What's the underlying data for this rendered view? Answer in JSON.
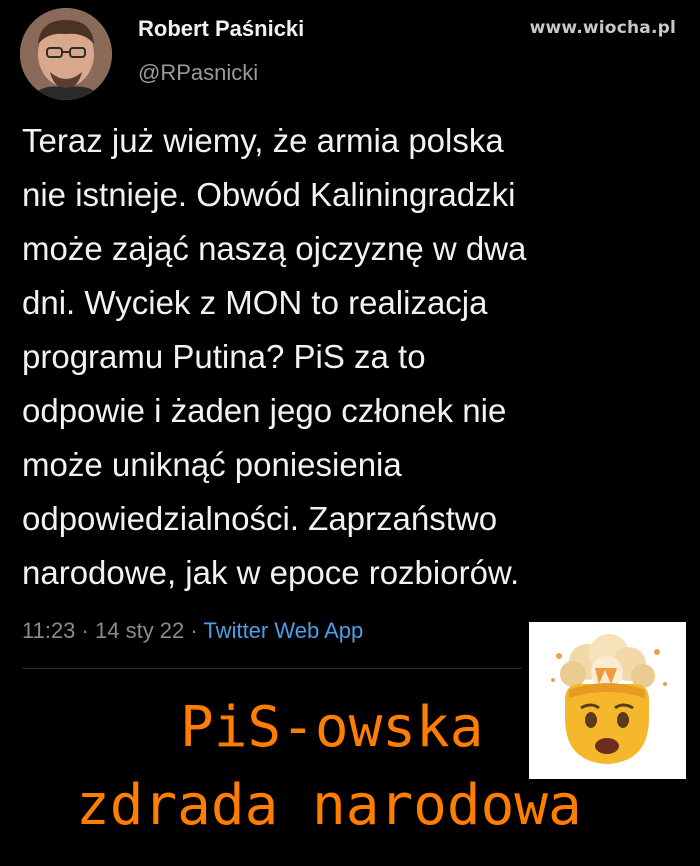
{
  "watermark": "www.wiocha.pl",
  "tweet": {
    "author_name": "Robert Paśnicki",
    "author_handle": "@RPasnicki",
    "text_lines": [
      "Teraz już wiemy, że armia polska",
      "nie istnieje. Obwód Kaliningradzki",
      "może zająć naszą ojczyznę w dwa",
      "dni. Wyciek z MON to realizacja",
      "programu Putina? PiS za to",
      "odpowie i żaden jego członek nie",
      "może uniknąć poniesienia",
      "odpowiedzialności. Zaprzaństwo",
      "narodowe, jak w epoce rozbiorów."
    ],
    "time": "11:23",
    "date": "14 sty 22",
    "separator": "·",
    "source": "Twitter Web App"
  },
  "caption": {
    "line1": "PiS-owska",
    "line2": "zdrada narodowa"
  },
  "icons": {
    "avatar": "profile-photo",
    "emoji": "exploding-head-emoji"
  },
  "colors": {
    "background": "#000000",
    "text": "#f2f2f2",
    "muted": "#8c8c8c",
    "link": "#4a9fe8",
    "caption": "#ff7d00"
  }
}
